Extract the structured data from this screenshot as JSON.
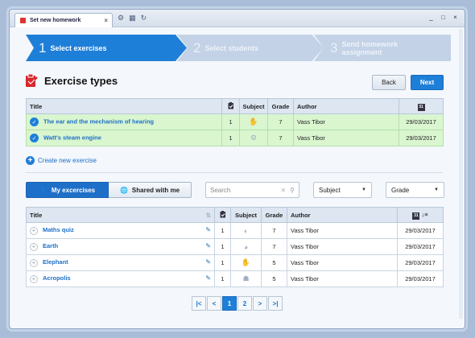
{
  "window": {
    "tab_title": "Set new homework",
    "tab_close": "×",
    "controls": [
      "_",
      "□",
      "×"
    ]
  },
  "wizard": {
    "steps": [
      {
        "num": "1",
        "label": "Select exercises",
        "state": "active"
      },
      {
        "num": "2",
        "label": "Select students",
        "state": "inactive"
      },
      {
        "num": "3",
        "label": "Send homework assignment",
        "state": "inactive"
      }
    ]
  },
  "page": {
    "title": "Exercise types",
    "back_label": "Back",
    "next_label": "Next"
  },
  "selected_table": {
    "headers": [
      "Title",
      "Subject",
      "Grade",
      "Author"
    ],
    "rows": [
      {
        "title": "The ear and the mechanism of hearing",
        "count": "1",
        "grade": "7",
        "author": "Vass Tibor",
        "date": "29/03/2017"
      },
      {
        "title": "Watt's steam engine",
        "count": "1",
        "grade": "7",
        "author": "Vass Tibor",
        "date": "29/03/2017"
      }
    ]
  },
  "create_label": "Create new exercise",
  "filters": {
    "my_exercises": "My excercises",
    "shared_with_me": "Shared with me",
    "search_placeholder": "Search",
    "subject": "Subject",
    "grade": "Grade"
  },
  "list_table": {
    "headers": [
      "Title",
      "Subject",
      "Grade",
      "Author"
    ],
    "rows": [
      {
        "title": "Maths quiz",
        "count": "1",
        "grade": "7",
        "author": "Vass Tibor",
        "date": "29/03/2017"
      },
      {
        "title": "Earth",
        "count": "1",
        "grade": "7",
        "author": "Vass Tibor",
        "date": "29/03/2017"
      },
      {
        "title": "Elephant",
        "count": "1",
        "grade": "5",
        "author": "Vass Tibor",
        "date": "29/03/2017"
      },
      {
        "title": "Acropolis",
        "count": "1",
        "grade": "5",
        "author": "Vass Tibor",
        "date": "29/03/2017"
      }
    ]
  },
  "pagination": {
    "first": "|<",
    "prev": "<",
    "pages": [
      "1",
      "2"
    ],
    "current": "1",
    "next": ">",
    "last": ">|"
  },
  "colors": {
    "accent": "#1e7fd8",
    "selected_row": "#d9f6cf"
  }
}
